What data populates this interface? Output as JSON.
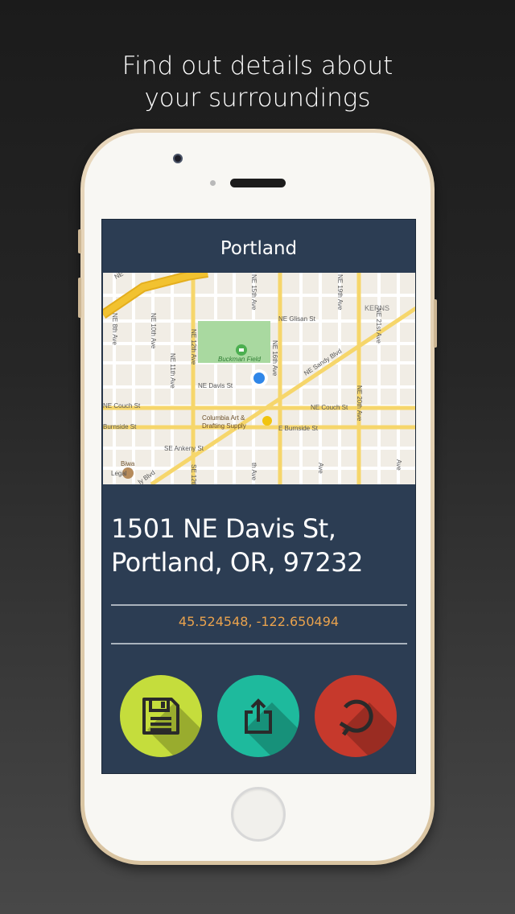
{
  "promo": {
    "headline_line1": "Find out details about",
    "headline_line2": "your surroundings"
  },
  "app": {
    "title": "Portland",
    "address_line1": "1501 NE Davis St,",
    "address_line2": "Portland, OR, 97232",
    "coordinates": "45.524548, -122.650494"
  },
  "map": {
    "labels": {
      "ne_glisan": "NE Glisan St",
      "kerns": "KERNS",
      "buckman_field": "Buckman Field",
      "ne_sandy": "NE Sandy Blvd",
      "ne_davis": "NE Davis St",
      "ne_couch_left": "NE Couch St",
      "ne_couch_right": "NE Couch St",
      "burnside_left": "Burnside St",
      "e_burnside": "E Burnside St",
      "columbia_1": "Columbia Art &",
      "columbia_2": "Drafting Supply",
      "se_ankeny": "SE Ankeny St",
      "biwa": "Biwa",
      "legal": "Legal",
      "sandy_bottom": "ly Blvd",
      "ne_8th": "NE 8th Ave",
      "ne_10th": "NE 10th Ave",
      "ne_11th": "NE 11th Ave",
      "ne_12th": "NE 12th Ave",
      "ne_15th": "NE 15th Ave",
      "ne_16th": "NE 16th Ave",
      "ne_19th": "NE 19th Ave",
      "ne_20th": "NE 20th Ave",
      "ne_21st": "NE 21st Ave",
      "se_12th": "SE 12th",
      "ave_a": "th Ave",
      "ave_b": "Ave",
      "ave_c": "Ave",
      "ne_top": "NE"
    },
    "colors": {
      "land": "#f1ede5",
      "street": "#ffffff",
      "arterial": "#f6d66b",
      "highway": "#f2c230",
      "park": "#a9d9a0",
      "location": "#2f86e8"
    }
  },
  "actions": {
    "save": {
      "color": "#c5dd3c",
      "icon": "floppy-disk-icon"
    },
    "share": {
      "color": "#1eba9d",
      "icon": "share-icon"
    },
    "refresh": {
      "color": "#c6392c",
      "icon": "refresh-icon"
    }
  },
  "theme": {
    "panel": "#2c3d53",
    "accent": "#e9a24d",
    "phone_frame": "#e8d7bc"
  }
}
